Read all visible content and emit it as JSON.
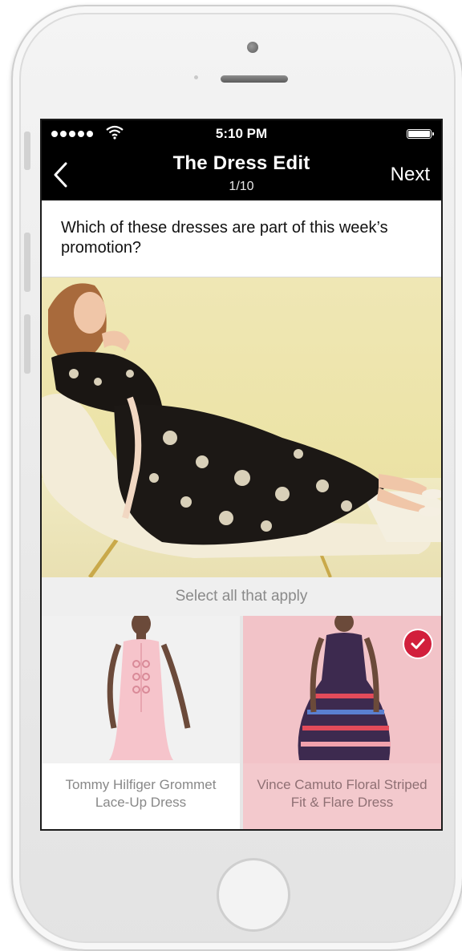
{
  "status_bar": {
    "time": "5:10 PM"
  },
  "nav": {
    "title": "The Dress Edit",
    "subtitle": "1/10",
    "next_label": "Next"
  },
  "question": {
    "text": "Which of these dresses are part of this week’s promotion?"
  },
  "hero": {
    "image": "woman-in-floral-dress"
  },
  "select": {
    "instruction": "Select all that apply"
  },
  "options": [
    {
      "caption": "Tommy Hilfiger Grommet Lace-Up Dress",
      "selected": false
    },
    {
      "caption": "Vince Camuto Floral Striped Fit & Flare Dress",
      "selected": true
    }
  ],
  "colors": {
    "accent": "#d21f3c",
    "selected_bg": "#f3c9cd",
    "navbar": "#000000"
  }
}
